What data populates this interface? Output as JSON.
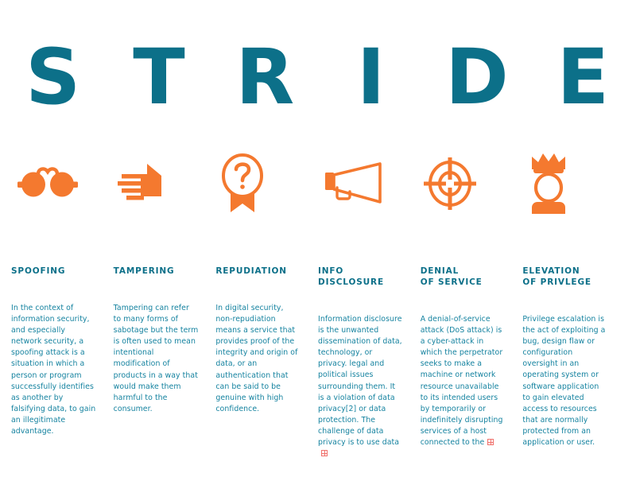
{
  "page": {
    "title": "STRIDE",
    "background_color": "#ffffff",
    "accent_teal": "#0c7089",
    "accent_orange": "#f4792f",
    "body_text_color": "#1683a0",
    "overset_marker_color": "#f0716c"
  },
  "wordmark": {
    "letters": [
      "S",
      "T",
      "R",
      "I",
      "D",
      "E"
    ]
  },
  "columns": [
    {
      "letter": "S",
      "icon": "sunglasses-icon",
      "heading": "SPOOFING",
      "body": "In the context of information security, and especially network security, a spoofing attack is a situation in which a person or\nprogram successfully identifies as another by falsifying data, to gain an illegitimate advantage.",
      "overset": false
    },
    {
      "letter": "T",
      "icon": "hand-icon",
      "heading": "TAMPERING",
      "body": "Tampering can refer to many forms of sabotage but the term is often used to mean intentional modification of products in a way that would make them harmful to the consumer.",
      "overset": false
    },
    {
      "letter": "R",
      "icon": "question-badge-icon",
      "heading": "REPUDIATION",
      "body": "In digital security, non-repudiation means a service that provides proof of the integrity and origin of data, or an authentication that can be said to be genuine with high confidence.",
      "overset": false
    },
    {
      "letter": "I",
      "icon": "megaphone-icon",
      "heading": "INFO\nDISCLOSURE",
      "body": "Information disclosure is the unwanted dissemination of data, technology, or privacy. legal and political issues surrounding them. It is a violation of data privacy[2] or data protection. The challenge of data privacy is to use data",
      "overset": true
    },
    {
      "letter": "D",
      "icon": "crosshair-target-icon",
      "heading": "DENIAL\nOF SERVICE",
      "body": "A denial-of-service attack (DoS attack) is a cyber-attack in which the perpetrator seeks to make a machine or network resource unavailable to its intended users by temporarily or indefinitely disrupting services of a host connected to the",
      "overset": true
    },
    {
      "letter": "E",
      "icon": "crowned-figure-icon",
      "heading": "ELEVATION\nOF PRIVLEGE",
      "body": "Privilege escalation is the act of exploiting a bug, design flaw or configuration oversight in an operating system or software application to gain elevated access to resources that are normally protected from an application or user.",
      "overset": false
    }
  ]
}
